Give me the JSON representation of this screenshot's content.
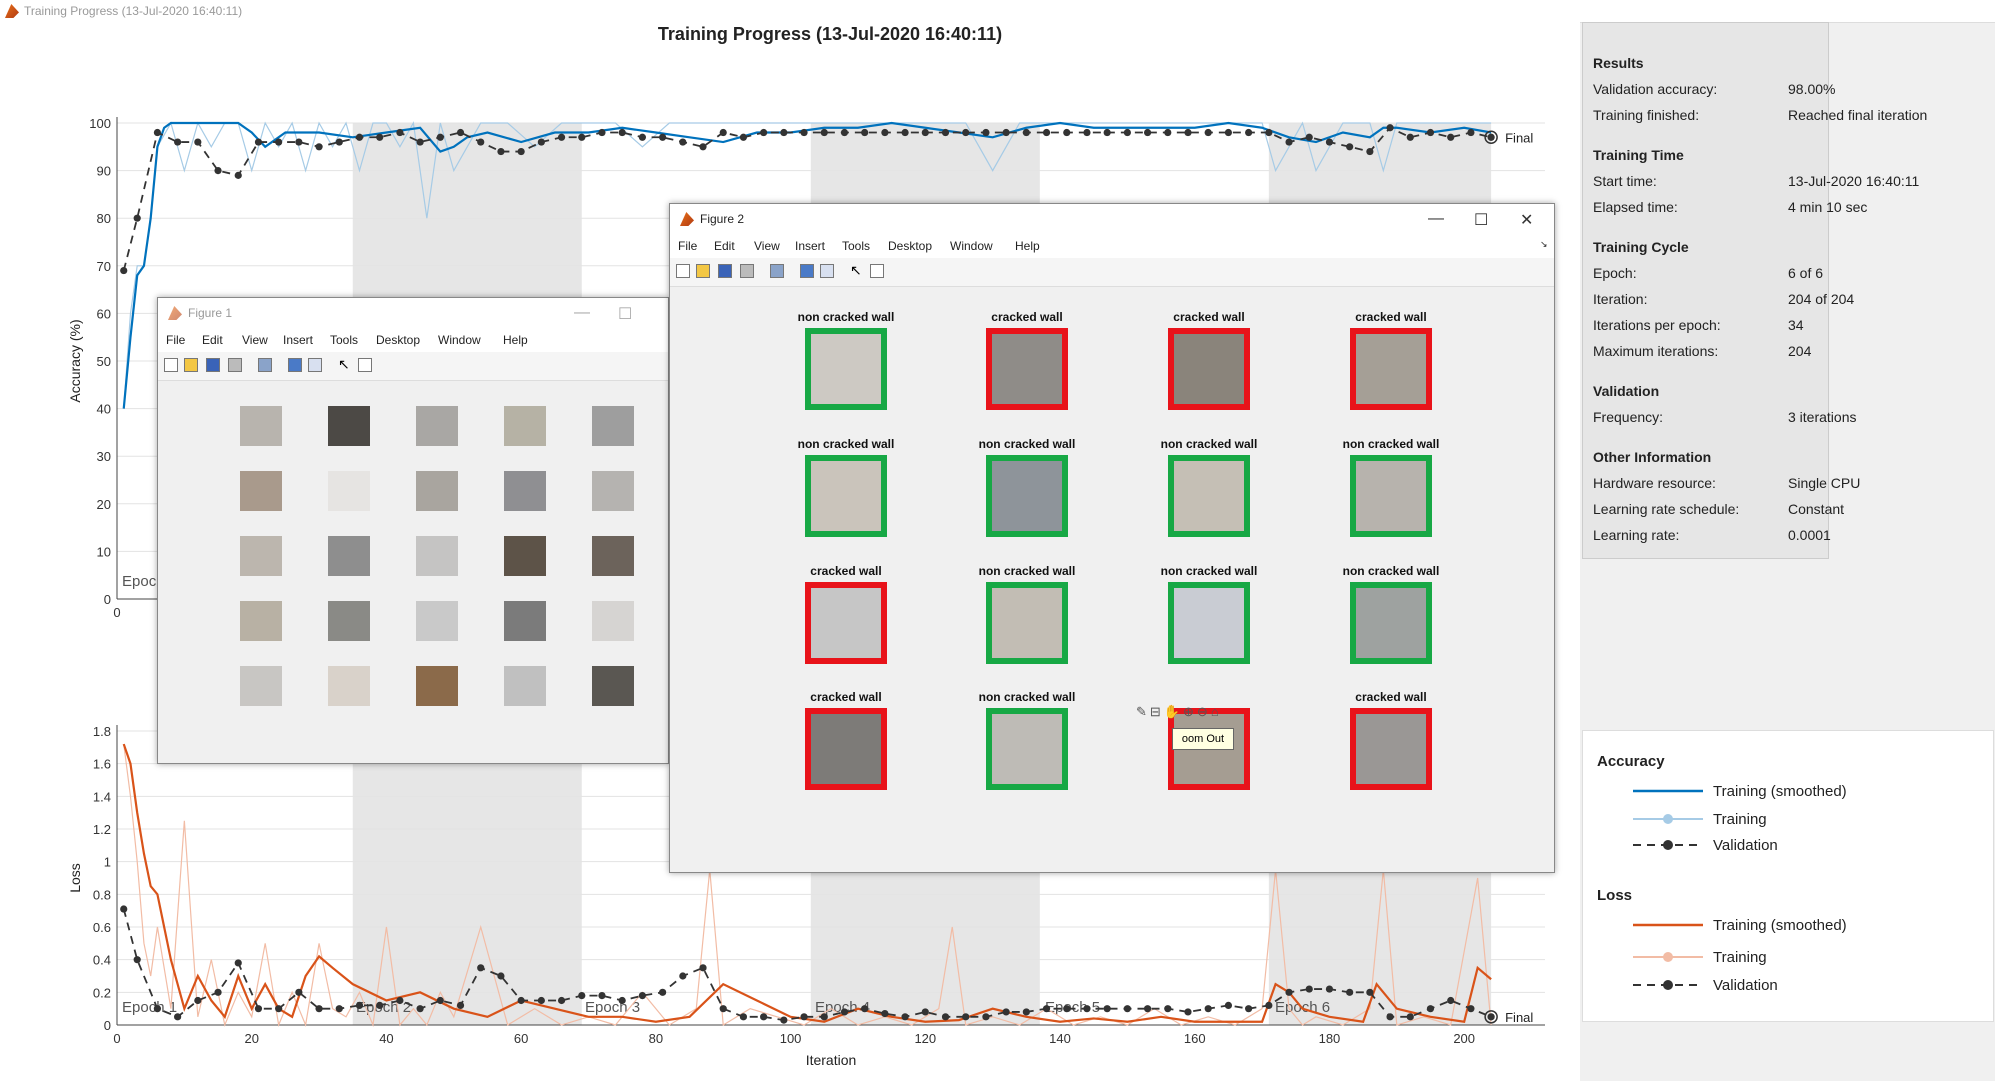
{
  "window": {
    "title": "Training Progress (13-Jul-2020 16:40:11)"
  },
  "plot": {
    "title": "Training Progress (13-Jul-2020 16:40:11)",
    "final_label": "Final",
    "epoch_labels": [
      "Epoch 1",
      "Epoch 2",
      "Epoch 3",
      "Epoch 4",
      "Epoch 5",
      "Epoch 6"
    ]
  },
  "chart_data": [
    {
      "type": "line",
      "ylabel": "Accuracy (%)",
      "xlim": [
        0,
        212
      ],
      "ylim": [
        0,
        100
      ],
      "yticks": [
        0,
        10,
        20,
        30,
        40,
        50,
        60,
        70,
        80,
        90,
        100
      ],
      "xticks": [
        0
      ],
      "series": [
        {
          "name": "Training (smoothed)",
          "color": "#0072bd",
          "x": [
            1,
            2,
            3,
            4,
            5,
            6,
            7,
            8,
            10,
            12,
            14,
            16,
            18,
            20,
            22,
            25,
            30,
            35,
            40,
            45,
            48,
            50,
            52,
            55,
            60,
            65,
            70,
            75,
            80,
            85,
            90,
            95,
            100,
            105,
            110,
            115,
            120,
            125,
            130,
            135,
            140,
            145,
            150,
            155,
            160,
            165,
            170,
            174,
            178,
            182,
            186,
            188,
            190,
            195,
            200,
            204
          ],
          "y": [
            40,
            55,
            68,
            70,
            80,
            95,
            99,
            100,
            100,
            100,
            100,
            100,
            100,
            98,
            95,
            98,
            98,
            97,
            98,
            99,
            94,
            95,
            97,
            98,
            96,
            98,
            98,
            99,
            98,
            97,
            96,
            98,
            98,
            99,
            99,
            100,
            99,
            98,
            97,
            99,
            100,
            99,
            99,
            99,
            99,
            100,
            99,
            97,
            96,
            98,
            97,
            99,
            99,
            98,
            99,
            98
          ]
        },
        {
          "name": "Training",
          "color": "#a6cbe6",
          "x": [
            1,
            2,
            3,
            4,
            5,
            6,
            8,
            10,
            12,
            14,
            16,
            18,
            20,
            22,
            24,
            26,
            28,
            30,
            32,
            34,
            36,
            38,
            40,
            42,
            44,
            46,
            48,
            50,
            54,
            58,
            62,
            66,
            70,
            74,
            78,
            82,
            86,
            90,
            94,
            98,
            102,
            106,
            110,
            114,
            118,
            122,
            126,
            130,
            134,
            138,
            142,
            146,
            150,
            154,
            158,
            162,
            166,
            170,
            172,
            174,
            176,
            178,
            182,
            186,
            188,
            190,
            194,
            198,
            202,
            204
          ],
          "y": [
            40,
            60,
            70,
            70,
            80,
            95,
            100,
            90,
            100,
            95,
            100,
            100,
            90,
            100,
            95,
            100,
            90,
            100,
            95,
            100,
            90,
            100,
            100,
            95,
            100,
            80,
            100,
            90,
            100,
            100,
            95,
            100,
            100,
            100,
            95,
            100,
            100,
            100,
            100,
            100,
            100,
            100,
            100,
            100,
            100,
            100,
            100,
            90,
            100,
            100,
            100,
            100,
            100,
            100,
            100,
            100,
            100,
            100,
            90,
            95,
            100,
            90,
            100,
            100,
            90,
            100,
            100,
            100,
            100,
            100
          ]
        },
        {
          "name": "Validation",
          "color": "#333333",
          "x": [
            1,
            3,
            6,
            9,
            12,
            15,
            18,
            21,
            24,
            27,
            30,
            33,
            36,
            39,
            42,
            45,
            48,
            51,
            54,
            57,
            60,
            63,
            66,
            69,
            72,
            75,
            78,
            81,
            84,
            87,
            90,
            93,
            96,
            99,
            102,
            105,
            108,
            111,
            114,
            117,
            120,
            123,
            126,
            129,
            132,
            135,
            138,
            141,
            144,
            147,
            150,
            153,
            156,
            159,
            162,
            165,
            168,
            171,
            174,
            177,
            180,
            183,
            186,
            189,
            192,
            195,
            198,
            201,
            204
          ],
          "y": [
            69,
            80,
            98,
            96,
            96,
            90,
            89,
            96,
            96,
            96,
            95,
            96,
            97,
            97,
            98,
            96,
            97,
            98,
            96,
            94,
            94,
            96,
            97,
            97,
            98,
            98,
            97,
            97,
            96,
            95,
            98,
            97,
            98,
            98,
            98,
            98,
            98,
            98,
            98,
            98,
            98,
            98,
            98,
            98,
            98,
            98,
            98,
            98,
            98,
            98,
            98,
            98,
            98,
            98,
            98,
            98,
            98,
            98,
            96,
            97,
            96,
            95,
            94,
            99,
            97,
            98,
            97,
            98,
            97
          ]
        }
      ]
    },
    {
      "type": "line",
      "xlabel": "Iteration",
      "ylabel": "Loss",
      "xlim": [
        0,
        212
      ],
      "ylim": [
        0,
        1.8
      ],
      "yticks": [
        0,
        0.2,
        0.4,
        0.6,
        0.8,
        1,
        1.2,
        1.4,
        1.6,
        1.8
      ],
      "xticks": [
        0,
        20,
        40,
        60,
        80,
        100,
        120,
        140,
        160,
        180,
        200
      ],
      "series": [
        {
          "name": "Training (smoothed)",
          "color": "#d95319",
          "x": [
            1,
            2,
            3,
            4,
            5,
            6,
            7,
            8,
            10,
            12,
            14,
            16,
            18,
            20,
            22,
            24,
            26,
            28,
            30,
            32,
            35,
            40,
            45,
            50,
            55,
            60,
            65,
            70,
            75,
            80,
            85,
            90,
            95,
            100,
            105,
            110,
            115,
            120,
            125,
            130,
            135,
            140,
            145,
            150,
            155,
            160,
            165,
            170,
            172,
            174,
            176,
            180,
            185,
            187,
            190,
            195,
            200,
            202,
            204
          ],
          "y": [
            1.72,
            1.6,
            1.3,
            1.05,
            0.85,
            0.8,
            0.6,
            0.4,
            0.1,
            0.3,
            0.15,
            0.05,
            0.3,
            0.1,
            0.25,
            0.1,
            0.05,
            0.3,
            0.42,
            0.35,
            0.25,
            0.15,
            0.2,
            0.1,
            0.05,
            0.15,
            0.1,
            0.05,
            0.05,
            0.02,
            0.05,
            0.25,
            0.15,
            0.05,
            0.02,
            0.1,
            0.05,
            0.02,
            0.03,
            0.1,
            0.05,
            0.02,
            0.04,
            0.02,
            0.05,
            0.02,
            0.02,
            0.02,
            0.25,
            0.2,
            0.1,
            0.05,
            0.02,
            0.25,
            0.1,
            0.05,
            0.02,
            0.35,
            0.28
          ]
        },
        {
          "name": "Training",
          "color": "#f2bca5",
          "x": [
            1,
            2,
            3,
            4,
            5,
            6,
            8,
            10,
            12,
            14,
            16,
            18,
            20,
            22,
            24,
            26,
            28,
            30,
            32,
            34,
            36,
            38,
            40,
            42,
            44,
            46,
            48,
            50,
            54,
            58,
            62,
            66,
            70,
            74,
            78,
            82,
            86,
            88,
            90,
            94,
            98,
            102,
            106,
            110,
            114,
            118,
            122,
            124,
            126,
            130,
            134,
            138,
            142,
            146,
            150,
            154,
            158,
            162,
            166,
            170,
            172,
            174,
            176,
            178,
            182,
            186,
            188,
            190,
            194,
            198,
            202,
            204
          ],
          "y": [
            1.72,
            1.4,
            1.0,
            0.5,
            0.3,
            0.6,
            0.1,
            1.25,
            0.05,
            0.4,
            0.0,
            0.2,
            0.05,
            0.5,
            0.0,
            0.2,
            0.0,
            0.5,
            0.1,
            0.05,
            0.2,
            0.0,
            0.6,
            0.0,
            0.1,
            0.0,
            0.2,
            0.05,
            0.6,
            0.0,
            0.1,
            0.0,
            0.05,
            0.0,
            0.2,
            0.0,
            0.1,
            0.95,
            0.0,
            0.1,
            0.05,
            0.0,
            0.1,
            0.0,
            0.05,
            0.0,
            0.1,
            0.6,
            0.0,
            0.05,
            0.0,
            0.1,
            0.0,
            0.05,
            0.0,
            0.1,
            0.0,
            0.05,
            0.0,
            0.1,
            0.95,
            0.1,
            0.0,
            0.05,
            0.0,
            0.1,
            0.95,
            0.0,
            0.05,
            0.0,
            0.9,
            0.0
          ]
        },
        {
          "name": "Validation",
          "color": "#333333",
          "x": [
            1,
            3,
            6,
            9,
            12,
            15,
            18,
            21,
            24,
            27,
            30,
            33,
            36,
            39,
            42,
            45,
            48,
            51,
            54,
            57,
            60,
            63,
            66,
            69,
            72,
            75,
            78,
            81,
            84,
            87,
            90,
            93,
            96,
            99,
            102,
            105,
            108,
            111,
            114,
            117,
            120,
            123,
            126,
            129,
            132,
            135,
            138,
            141,
            144,
            147,
            150,
            153,
            156,
            159,
            162,
            165,
            168,
            171,
            174,
            177,
            180,
            183,
            186,
            189,
            192,
            195,
            198,
            201,
            204
          ],
          "y": [
            0.71,
            0.4,
            0.1,
            0.05,
            0.15,
            0.2,
            0.38,
            0.1,
            0.1,
            0.2,
            0.1,
            0.1,
            0.12,
            0.12,
            0.15,
            0.1,
            0.15,
            0.12,
            0.35,
            0.3,
            0.15,
            0.15,
            0.15,
            0.18,
            0.18,
            0.15,
            0.18,
            0.2,
            0.3,
            0.35,
            0.1,
            0.05,
            0.05,
            0.03,
            0.05,
            0.05,
            0.08,
            0.1,
            0.07,
            0.05,
            0.08,
            0.05,
            0.05,
            0.05,
            0.08,
            0.08,
            0.1,
            0.1,
            0.1,
            0.1,
            0.1,
            0.1,
            0.1,
            0.08,
            0.1,
            0.12,
            0.1,
            0.12,
            0.2,
            0.22,
            0.22,
            0.2,
            0.2,
            0.05,
            0.05,
            0.1,
            0.15,
            0.1,
            0.05
          ]
        }
      ]
    }
  ],
  "results": {
    "heading": "Results",
    "rows": [
      {
        "k": "Validation accuracy:",
        "v": "98.00%"
      },
      {
        "k": "Training finished:",
        "v": "Reached final iteration"
      }
    ]
  },
  "training_time": {
    "heading": "Training Time",
    "rows": [
      {
        "k": "Start time:",
        "v": "13-Jul-2020 16:40:11"
      },
      {
        "k": "Elapsed time:",
        "v": "4 min 10 sec"
      }
    ]
  },
  "training_cycle": {
    "heading": "Training Cycle",
    "rows": [
      {
        "k": "Epoch:",
        "v": "6 of 6"
      },
      {
        "k": "Iteration:",
        "v": "204 of 204"
      },
      {
        "k": "Iterations per epoch:",
        "v": "34"
      },
      {
        "k": "Maximum iterations:",
        "v": "204"
      }
    ]
  },
  "validation": {
    "heading": "Validation",
    "rows": [
      {
        "k": "Frequency:",
        "v": "3 iterations"
      }
    ]
  },
  "other": {
    "heading": "Other Information",
    "rows": [
      {
        "k": "Hardware resource:",
        "v": "Single CPU"
      },
      {
        "k": "Learning rate schedule:",
        "v": "Constant"
      },
      {
        "k": "Learning rate:",
        "v": "0.0001"
      }
    ]
  },
  "legend": {
    "accuracy_heading": "Accuracy",
    "loss_heading": "Loss",
    "acc_items": [
      "Training (smoothed)",
      "Training",
      "Validation"
    ],
    "loss_items": [
      "Training (smoothed)",
      "Training",
      "Validation"
    ]
  },
  "figure1": {
    "title": "Figure 1",
    "menu": [
      "File",
      "Edit",
      "View",
      "Insert",
      "Tools",
      "Desktop",
      "Window",
      "Help"
    ]
  },
  "figure2": {
    "title": "Figure 2",
    "menu": [
      "File",
      "Edit",
      "View",
      "Insert",
      "Tools",
      "Desktop",
      "Window",
      "Help"
    ],
    "tiles": [
      {
        "label": "non cracked wall",
        "status": "correct"
      },
      {
        "label": "cracked wall",
        "status": "wrong"
      },
      {
        "label": "cracked wall",
        "status": "wrong"
      },
      {
        "label": "cracked wall",
        "status": "wrong"
      },
      {
        "label": "non cracked wall",
        "status": "correct"
      },
      {
        "label": "non cracked wall",
        "status": "correct"
      },
      {
        "label": "non cracked wall",
        "status": "correct"
      },
      {
        "label": "non cracked wall",
        "status": "correct"
      },
      {
        "label": "cracked wall",
        "status": "wrong"
      },
      {
        "label": "non cracked wall",
        "status": "correct"
      },
      {
        "label": "non cracked wall",
        "status": "correct"
      },
      {
        "label": "non cracked wall",
        "status": "correct"
      },
      {
        "label": "cracked wall",
        "status": "wrong"
      },
      {
        "label": "non cracked wall",
        "status": "correct"
      },
      {
        "label": "",
        "status": "wrong"
      },
      {
        "label": "cracked wall",
        "status": "wrong"
      }
    ],
    "tooltip": "oom Out"
  },
  "colors": {
    "correct": "#17a845",
    "wrong": "#e8131a",
    "epoch_band": "#e6e6e6"
  }
}
